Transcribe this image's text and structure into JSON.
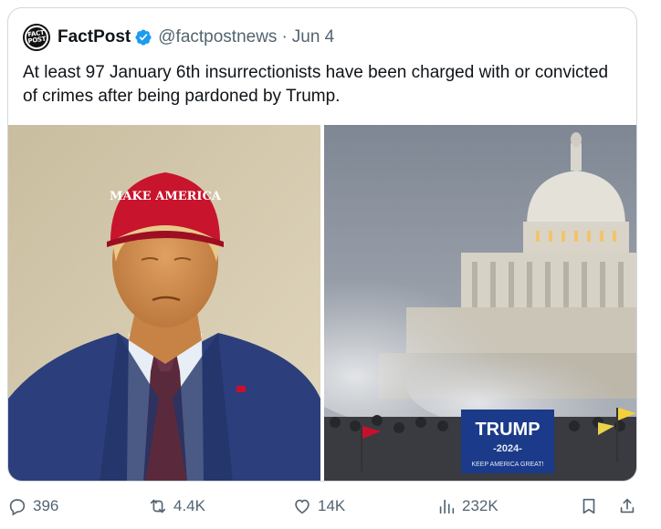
{
  "author": {
    "name": "FactPost",
    "handle": "@factpostnews",
    "separator": "·",
    "date": "Jun 4",
    "avatar_text_top": "FACT",
    "avatar_text_bottom": "POST",
    "verified_color": "#1d9bf0"
  },
  "tweet": {
    "text": "At least 97 January 6th insurrectionists have been charged with or convicted of crimes after being pardoned by Trump."
  },
  "media": {
    "left_photo": {
      "hat_text": "MAKE AMERICA"
    },
    "right_photo": {
      "banner_title": "TRUMP",
      "banner_year": "-2024-",
      "banner_slogan": "KEEP AMERICA GREAT!"
    }
  },
  "actions": {
    "replies": "396",
    "reposts": "4.4K",
    "likes": "14K",
    "views": "232K"
  },
  "icons": {
    "reply": "reply-icon",
    "repost": "repost-icon",
    "like": "heart-icon",
    "views": "views-icon",
    "bookmark": "bookmark-icon",
    "share": "share-icon"
  }
}
